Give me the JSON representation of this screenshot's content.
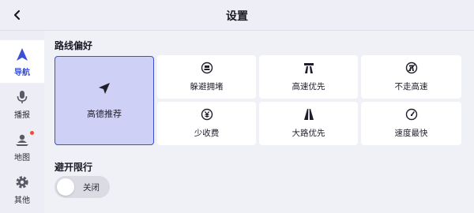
{
  "header": {
    "title": "设置"
  },
  "sidebar": {
    "items": [
      {
        "label": "导航",
        "icon": "navigation-arrow-icon",
        "active": true
      },
      {
        "label": "播报",
        "icon": "microphone-icon",
        "active": false
      },
      {
        "label": "地图",
        "icon": "map-person-icon",
        "active": false,
        "badge": true
      },
      {
        "label": "其他",
        "icon": "gear-icon",
        "active": false
      }
    ]
  },
  "route_preference": {
    "title": "路线偏好",
    "options": [
      {
        "label": "高德推荐",
        "icon": "send-arrow-icon",
        "selected": true
      },
      {
        "label": "躲避拥堵",
        "icon": "avoid-congestion-icon",
        "selected": false
      },
      {
        "label": "高速优先",
        "icon": "highway-icon",
        "selected": false
      },
      {
        "label": "不走高速",
        "icon": "no-highway-icon",
        "selected": false
      },
      {
        "label": "少收费",
        "icon": "yen-coin-icon",
        "selected": false
      },
      {
        "label": "大路优先",
        "icon": "main-road-icon",
        "selected": false
      },
      {
        "label": "速度最快",
        "icon": "speedometer-icon",
        "selected": false
      }
    ]
  },
  "avoid_restriction": {
    "title": "避开限行",
    "toggle_label": "关闭",
    "enabled": false
  },
  "colors": {
    "accent": "#3a4fd6",
    "selected_bg": "#cfd0f5",
    "badge": "#f04a3a"
  }
}
